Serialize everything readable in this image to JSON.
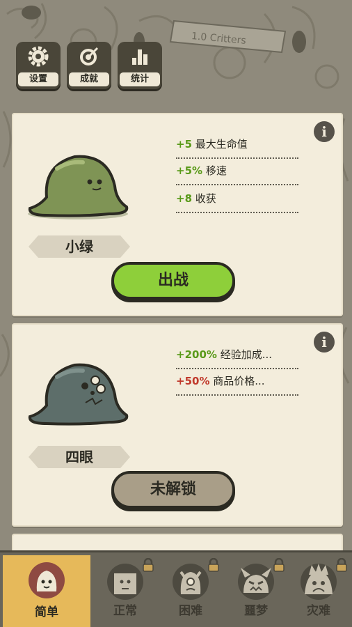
{
  "top_buttons": [
    {
      "label": "设置",
      "icon": "gear-icon"
    },
    {
      "label": "成就",
      "icon": "target-icon"
    },
    {
      "label": "统计",
      "icon": "bar-stats-icon"
    }
  ],
  "background_banner": "1.0 Critters",
  "creatures": [
    {
      "name": "小绿",
      "color": "#7f9455",
      "stats": [
        {
          "value": "+5",
          "text": "最大生命值",
          "tone": "green"
        },
        {
          "value": "+5%",
          "text": "移速",
          "tone": "green"
        },
        {
          "value": "+8",
          "text": "收获",
          "tone": "green"
        }
      ],
      "action_label": "出战",
      "locked": false
    },
    {
      "name": "四眼",
      "color": "#5d6e6a",
      "stats": [
        {
          "value": "+200%",
          "text": "经验加成...",
          "tone": "green"
        },
        {
          "value": "+50%",
          "text": "商品价格...",
          "tone": "red"
        }
      ],
      "action_label": "未解锁",
      "locked": true
    }
  ],
  "difficulty_tabs": [
    {
      "label": "简单",
      "icon": "easy-face-icon",
      "active": true,
      "locked": false
    },
    {
      "label": "正常",
      "icon": "normal-face-icon",
      "active": false,
      "locked": true
    },
    {
      "label": "困难",
      "icon": "hard-face-icon",
      "active": false,
      "locked": true
    },
    {
      "label": "噩梦",
      "icon": "nightmare-face-icon",
      "active": false,
      "locked": true
    },
    {
      "label": "灾难",
      "icon": "disaster-face-icon",
      "active": false,
      "locked": true
    }
  ],
  "colors": {
    "green_stat": "#5a9a1a",
    "red_stat": "#c0392b",
    "active_tab": "#e6b95a",
    "go_button": "#8ecf3a"
  }
}
